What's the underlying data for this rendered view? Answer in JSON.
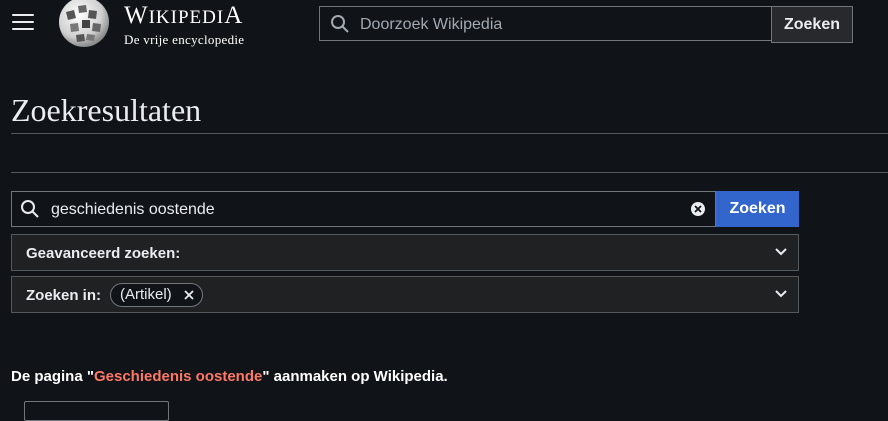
{
  "header": {
    "title": "Wikipedia",
    "tagline": "De vrije encyclopedie",
    "search": {
      "placeholder": "Doorzoek Wikipedia",
      "value": "",
      "button_label": "Zoeken"
    }
  },
  "main": {
    "page_title": "Zoekresultaten",
    "search": {
      "value": "geschiedenis oostende",
      "button_label": "Zoeken"
    },
    "advanced": {
      "label": "Geavanceerd zoeken:"
    },
    "namespaces": {
      "label": "Zoeken in:",
      "chip": "(Artikel)"
    },
    "create": {
      "prefix": "De pagina \"",
      "link": "Geschiedenis oostende",
      "suffix": "\" aanmaken op Wikipedia."
    }
  },
  "colors": {
    "background": "#101418",
    "accent": "#3366cc",
    "red_link": "#fd7865"
  }
}
